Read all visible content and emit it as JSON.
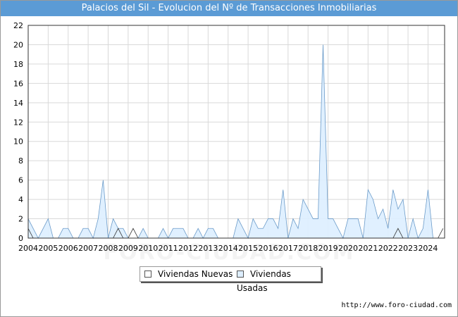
{
  "chart_data": {
    "type": "area",
    "title": "Palacios del Sil - Evolucion del Nº de Transacciones Inmobiliarias",
    "xlabel": "",
    "ylabel": "",
    "ylim": [
      0,
      22
    ],
    "yticks": [
      0,
      2,
      4,
      6,
      8,
      10,
      12,
      14,
      16,
      18,
      20,
      22
    ],
    "xlim": [
      2004,
      2024.83
    ],
    "xticks": [
      2004,
      2005,
      2006,
      2007,
      2008,
      2009,
      2010,
      2011,
      2012,
      2013,
      2014,
      2015,
      2016,
      2017,
      2018,
      2019,
      2020,
      2021,
      2022,
      2023,
      2024
    ],
    "xtick_labels": [
      "2004",
      "2005",
      "2006",
      "2007",
      "2008",
      "2009",
      "2010",
      "2011",
      "2012",
      "2013",
      "2014",
      "2015",
      "2016",
      "2017",
      "2018",
      "2019",
      "2020",
      "2021",
      "2022",
      "2023",
      "2024"
    ],
    "grid": true,
    "legend_position": "bottom-center",
    "x": [
      2004.0,
      2004.25,
      2004.5,
      2004.75,
      2005.0,
      2005.25,
      2005.5,
      2005.75,
      2006.0,
      2006.25,
      2006.5,
      2006.75,
      2007.0,
      2007.25,
      2007.5,
      2007.75,
      2008.0,
      2008.25,
      2008.5,
      2008.75,
      2009.0,
      2009.25,
      2009.5,
      2009.75,
      2010.0,
      2010.25,
      2010.5,
      2010.75,
      2011.0,
      2011.25,
      2011.5,
      2011.75,
      2012.0,
      2012.25,
      2012.5,
      2012.75,
      2013.0,
      2013.25,
      2013.5,
      2013.75,
      2014.0,
      2014.25,
      2014.5,
      2014.75,
      2015.0,
      2015.25,
      2015.5,
      2015.75,
      2016.0,
      2016.25,
      2016.5,
      2016.75,
      2017.0,
      2017.25,
      2017.5,
      2017.75,
      2018.0,
      2018.25,
      2018.5,
      2018.75,
      2019.0,
      2019.25,
      2019.5,
      2019.75,
      2020.0,
      2020.25,
      2020.5,
      2020.75,
      2021.0,
      2021.25,
      2021.5,
      2021.75,
      2022.0,
      2022.25,
      2022.5,
      2022.75,
      2023.0,
      2023.25,
      2023.5,
      2023.75,
      2024.0,
      2024.25,
      2024.5,
      2024.75
    ],
    "series": [
      {
        "name": "Viviendas Nuevas",
        "color": "#ffffff",
        "stroke": "#333333",
        "values": [
          1,
          0,
          0,
          0,
          0,
          0,
          0,
          0,
          0,
          0,
          0,
          0,
          0,
          0,
          0,
          0,
          0,
          0,
          1,
          0,
          0,
          1,
          0,
          0,
          0,
          0,
          0,
          0,
          0,
          0,
          0,
          0,
          0,
          0,
          0,
          0,
          0,
          0,
          0,
          0,
          0,
          0,
          0,
          0,
          0,
          0,
          0,
          0,
          0,
          0,
          0,
          0,
          0,
          0,
          0,
          0,
          0,
          0,
          0,
          0,
          0,
          0,
          0,
          0,
          0,
          0,
          0,
          0,
          0,
          0,
          0,
          0,
          0,
          0,
          1,
          0,
          0,
          0,
          0,
          0,
          0,
          0,
          0,
          1
        ]
      },
      {
        "name": "Viviendas Usadas",
        "color": "#ddeeff",
        "stroke": "#6b9bc9",
        "values": [
          2,
          1,
          0,
          1,
          2,
          0,
          0,
          1,
          1,
          0,
          0,
          1,
          1,
          0,
          2,
          6,
          0,
          2,
          1,
          1,
          0,
          0,
          0,
          1,
          0,
          0,
          0,
          1,
          0,
          1,
          1,
          1,
          0,
          0,
          1,
          0,
          1,
          1,
          0,
          0,
          0,
          0,
          2,
          1,
          0,
          2,
          1,
          1,
          2,
          2,
          1,
          5,
          0,
          2,
          1,
          4,
          3,
          2,
          2,
          20,
          2,
          2,
          1,
          0,
          2,
          2,
          2,
          0,
          5,
          4,
          2,
          3,
          1,
          5,
          3,
          4,
          0,
          2,
          0,
          1,
          5,
          0,
          0,
          0
        ]
      }
    ]
  },
  "legend": {
    "nuevas_label": "Viviendas Nuevas",
    "usadas_label": "Viviendas Usadas"
  },
  "footer": {
    "source": "http://www.foro-ciudad.com"
  },
  "watermark": "FORO-CIUDAD.COM"
}
